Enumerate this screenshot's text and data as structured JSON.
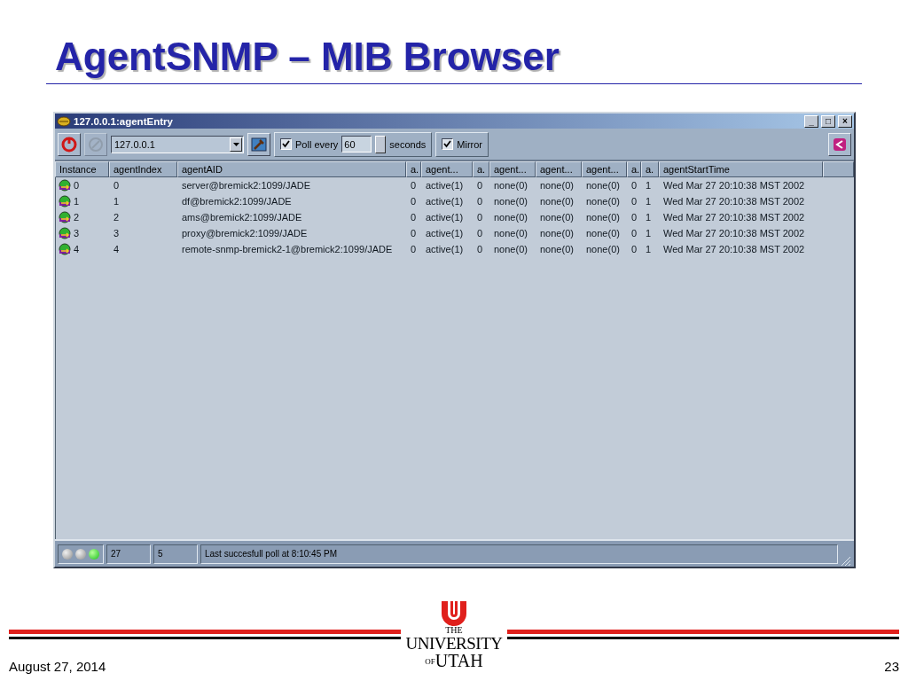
{
  "slide": {
    "title": "AgentSNMP – MIB Browser",
    "date": "August 27, 2014",
    "page": "23",
    "logo": {
      "the": "THE",
      "university": "UNIVERSITY",
      "of": "OF",
      "utah": "UTAH"
    }
  },
  "window": {
    "title": "127.0.0.1:agentEntry",
    "controls": [
      "_",
      "□",
      "×"
    ]
  },
  "toolbar": {
    "refresh": {
      "disabled": false
    },
    "stop": {
      "disabled": true
    },
    "address": "127.0.0.1",
    "poll": {
      "label": "Poll every",
      "checked": true,
      "value": "60",
      "unit": "seconds"
    },
    "mirror": {
      "label": "Mirror",
      "checked": true
    }
  },
  "table": {
    "columns": [
      "Instance",
      "agentIndex",
      "agentAID",
      "a.",
      "agent...",
      "a.",
      "agent...",
      "agent...",
      "agent...",
      "a.",
      "a.",
      "agentStartTime"
    ],
    "rows": [
      [
        "0",
        "0",
        "server@bremick2:1099/JADE",
        "0",
        "active(1)",
        "0",
        "none(0)",
        "none(0)",
        "none(0)",
        "0",
        "1",
        "Wed Mar 27 20:10:38 MST 2002"
      ],
      [
        "1",
        "1",
        "df@bremick2:1099/JADE",
        "0",
        "active(1)",
        "0",
        "none(0)",
        "none(0)",
        "none(0)",
        "0",
        "1",
        "Wed Mar 27 20:10:38 MST 2002"
      ],
      [
        "2",
        "2",
        "ams@bremick2:1099/JADE",
        "0",
        "active(1)",
        "0",
        "none(0)",
        "none(0)",
        "none(0)",
        "0",
        "1",
        "Wed Mar 27 20:10:38 MST 2002"
      ],
      [
        "3",
        "3",
        "proxy@bremick2:1099/JADE",
        "0",
        "active(1)",
        "0",
        "none(0)",
        "none(0)",
        "none(0)",
        "0",
        "1",
        "Wed Mar 27 20:10:38 MST 2002"
      ],
      [
        "4",
        "4",
        "remote-snmp-bremick2-1@bremick2:1099/JADE",
        "0",
        "active(1)",
        "0",
        "none(0)",
        "none(0)",
        "none(0)",
        "0",
        "1",
        "Wed Mar 27 20:10:38 MST 2002"
      ]
    ]
  },
  "status_bar": {
    "lights": [
      {
        "on": false
      },
      {
        "on": false
      },
      {
        "on": true
      }
    ],
    "fields": [
      "27",
      "5",
      "Last succesfull poll at 8:10:45 PM"
    ]
  }
}
